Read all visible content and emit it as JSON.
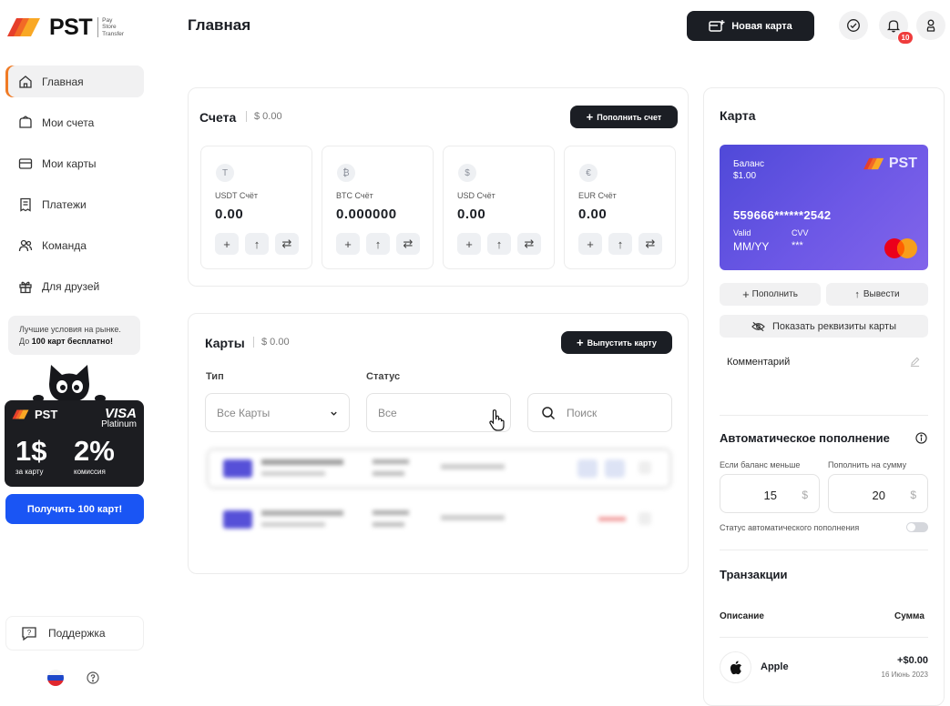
{
  "brand": {
    "name": "PST",
    "sub": [
      "Pay",
      "Store",
      "Transfer"
    ]
  },
  "sidebar": {
    "items": [
      {
        "label": "Главная"
      },
      {
        "label": "Мои счета"
      },
      {
        "label": "Мои карты"
      },
      {
        "label": "Платежи"
      },
      {
        "label": "Команда"
      },
      {
        "label": "Для друзей"
      }
    ],
    "promo": {
      "line1": "Лучшие условия на рынке.",
      "line2_prefix": "До ",
      "line2_bold": "100 карт бесплатно!",
      "card_brand": "PST",
      "card_network": "VISA",
      "card_tier": "Platinum",
      "stat1_value": "1$",
      "stat1_label": "за карту",
      "stat2_value": "2%",
      "stat2_label": "комиссия",
      "button": "Получить 100 карт!"
    },
    "support": "Поддержка"
  },
  "header": {
    "title": "Главная",
    "new_card": "Новая карта",
    "notifications_count": "10"
  },
  "accounts": {
    "title": "Счета",
    "total": "$ 0.00",
    "topup_button": "Пополнить счет",
    "items": [
      {
        "icon": "T",
        "label": "USDT Счёт",
        "value": "0.00"
      },
      {
        "icon": "₿",
        "label": "BTC Счёт",
        "value": "0.000000"
      },
      {
        "icon": "$",
        "label": "USD Счёт",
        "value": "0.00"
      },
      {
        "icon": "€",
        "label": "EUR Счёт",
        "value": "0.00"
      }
    ]
  },
  "cards": {
    "title": "Карты",
    "total": "$ 0.00",
    "issue_button": "Выпустить карту",
    "type_label": "Тип",
    "type_value": "Все Карты",
    "status_label": "Статус",
    "status_value": "Все",
    "search_placeholder": "Поиск"
  },
  "card_panel": {
    "title": "Карта",
    "balance_label": "Баланс",
    "balance_value": "$1.00",
    "card_brand": "PST",
    "number": "559666******2542",
    "valid_label": "Valid",
    "valid_value": "MM/YY",
    "cvv_label": "CVV",
    "cvv_value": "***",
    "topup": "Пополнить",
    "withdraw": "Вывести",
    "show_details": "Показать реквизиты карты",
    "comment": "Комментарий"
  },
  "auto_topup": {
    "title": "Автоматическое пополнение",
    "if_less_label": "Если баланс меньше",
    "if_less_value": "15",
    "topup_amount_label": "Пополнить на сумму",
    "topup_amount_value": "20",
    "currency": "$",
    "status_label": "Статус автоматического пополнения"
  },
  "transactions": {
    "title": "Транзакции",
    "col_description": "Описание",
    "col_amount": "Сумма",
    "rows": [
      {
        "name": "Apple",
        "amount": "+$0.00",
        "date": "16 Июнь 2023"
      }
    ]
  },
  "colors": {
    "accent_orange": "#f07b25",
    "primary_blue": "#1a55f4",
    "dark": "#1b1e24",
    "card_purple": "#5b4fe0",
    "badge_red": "#ef3c3c"
  }
}
